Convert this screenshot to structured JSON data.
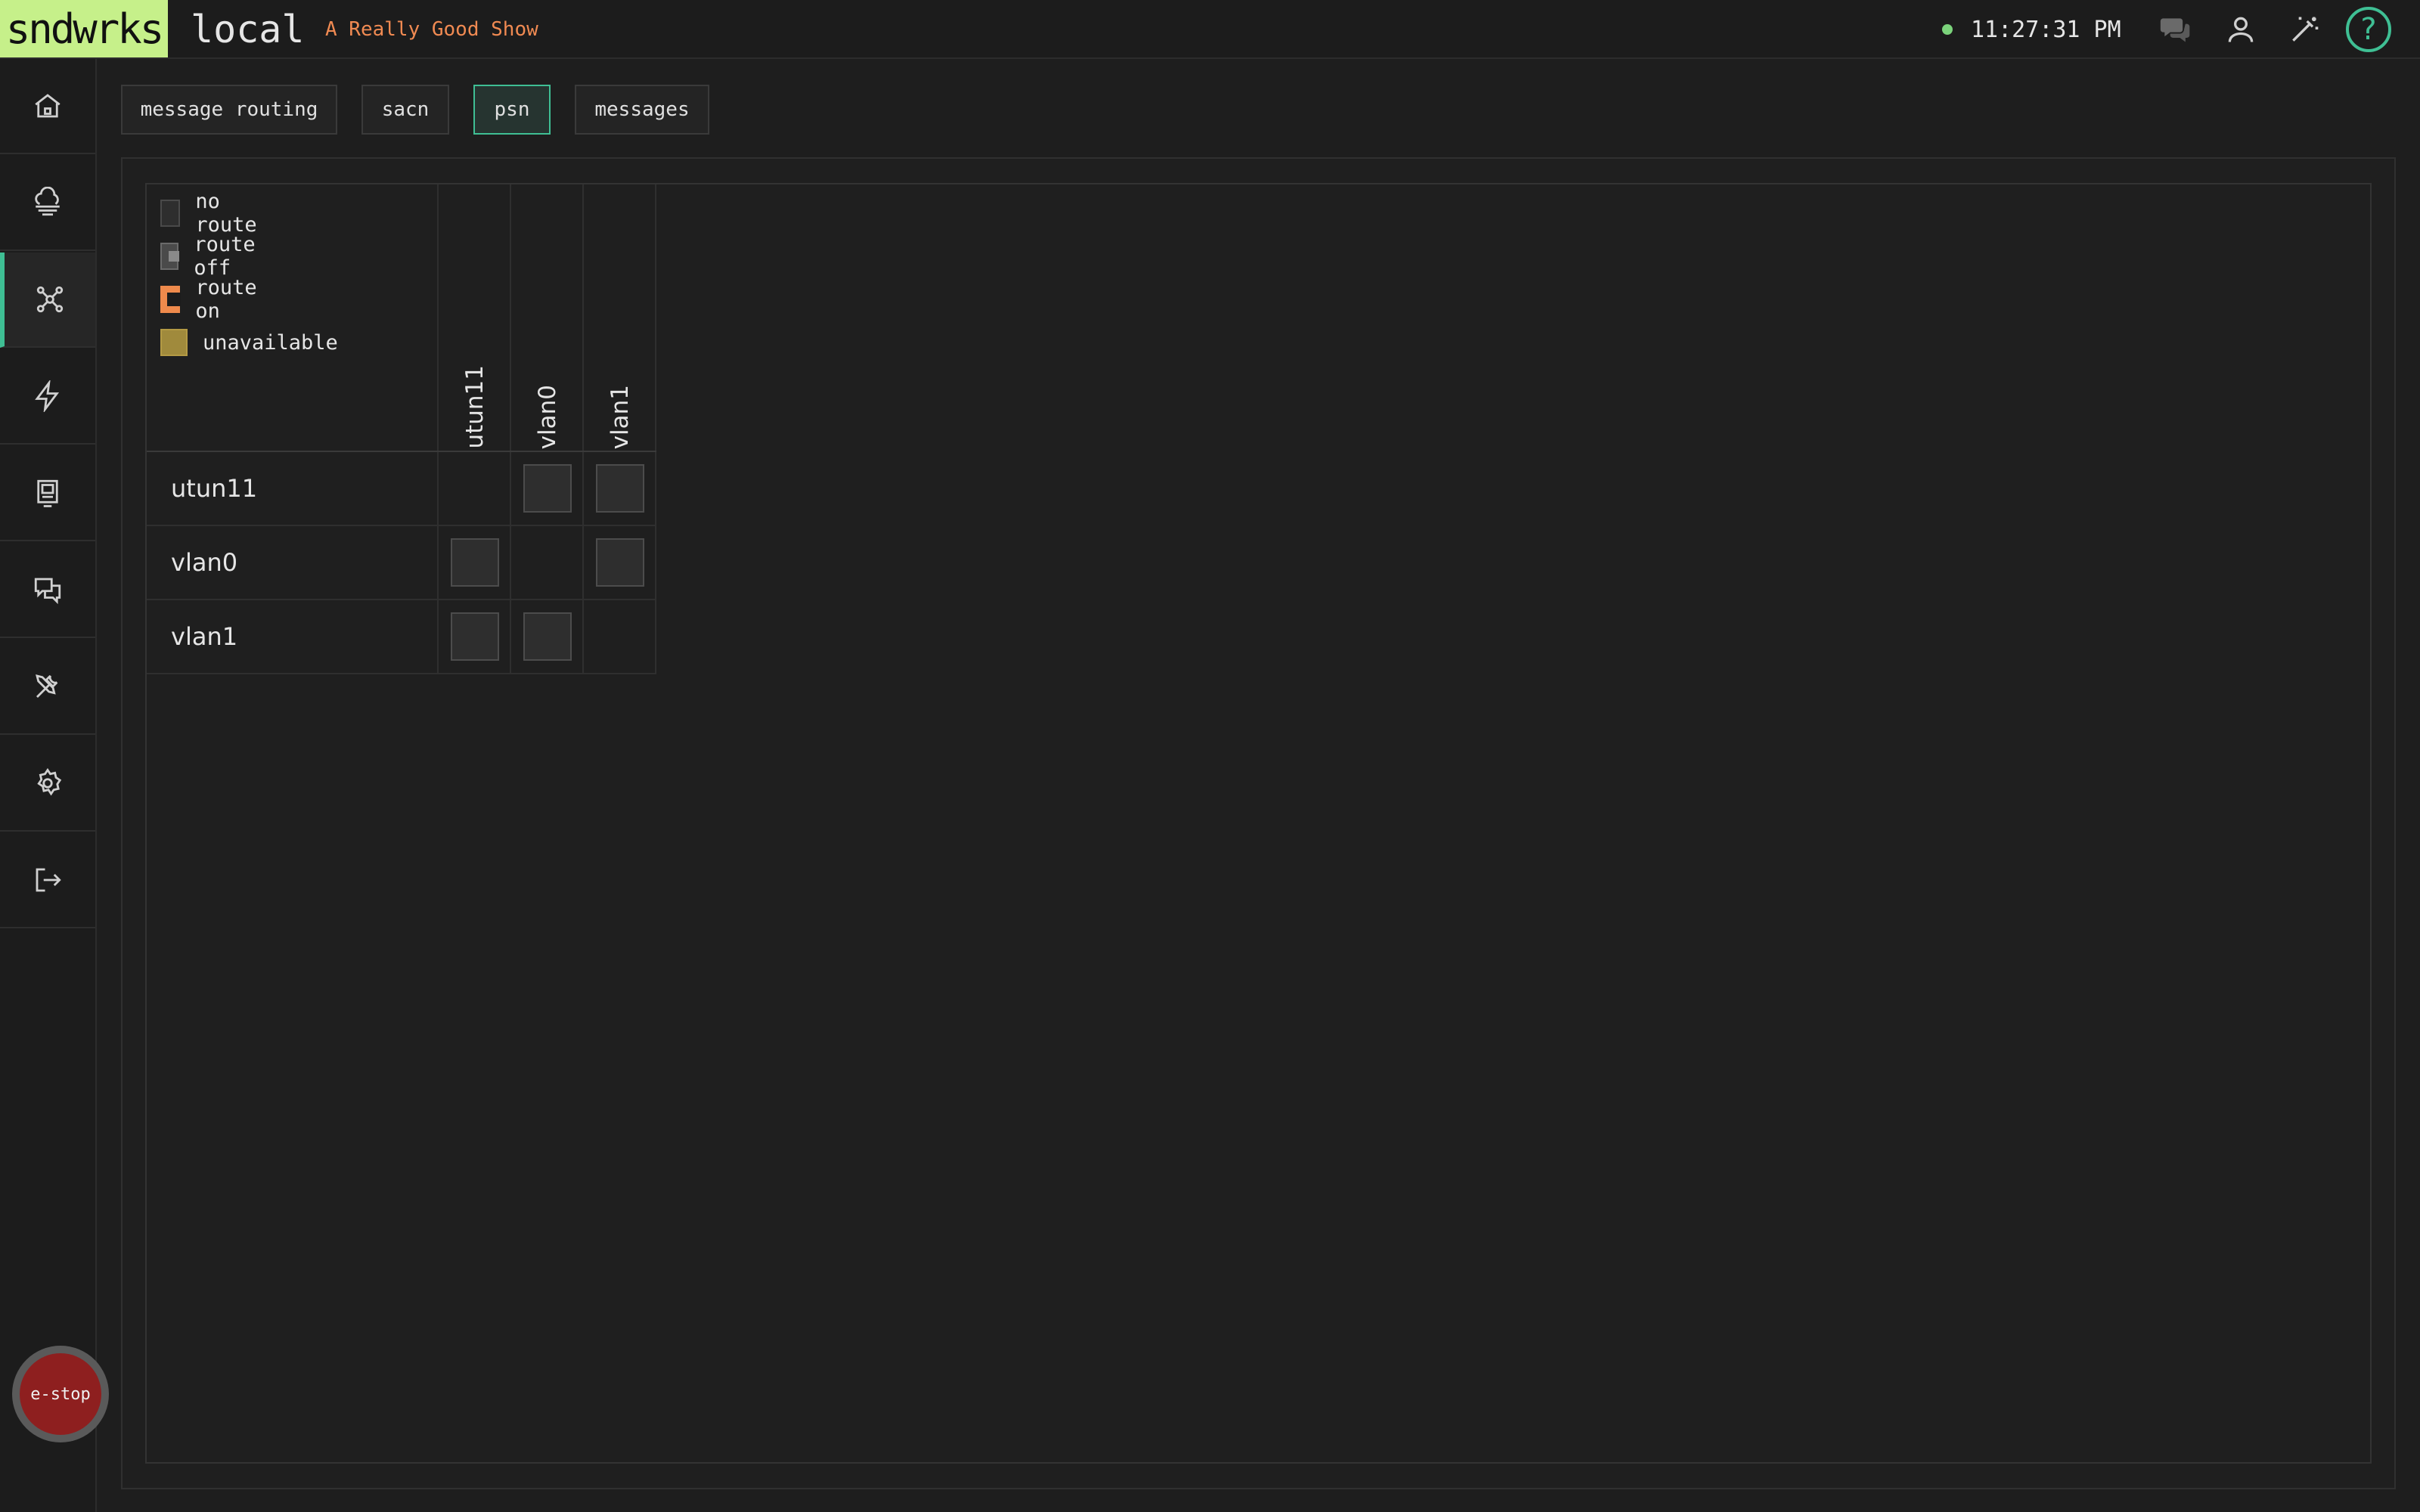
{
  "header": {
    "brand": "sndwrks",
    "instance": "local",
    "show_name": "A Really Good Show",
    "clock": "11:27:31 PM",
    "status_color": "#7bd37b",
    "help_label": "?",
    "icons": [
      "chat-icon",
      "user-icon",
      "magic-wand-icon",
      "help-icon"
    ]
  },
  "sidebar": {
    "items": [
      {
        "name": "home",
        "icon": "home-icon"
      },
      {
        "name": "cloud",
        "icon": "cloud-icon"
      },
      {
        "name": "network",
        "icon": "network-icon",
        "active": true
      },
      {
        "name": "triggers",
        "icon": "lightning-icon"
      },
      {
        "name": "display",
        "icon": "monitor-icon"
      },
      {
        "name": "messages",
        "icon": "chat-bubbles-icon"
      },
      {
        "name": "tools",
        "icon": "tools-icon"
      },
      {
        "name": "settings",
        "icon": "gear-icon"
      },
      {
        "name": "logout",
        "icon": "logout-icon"
      }
    ],
    "estop_label": "e-stop"
  },
  "tabs": [
    {
      "label": "message routing",
      "active": false
    },
    {
      "label": "sacn",
      "active": false
    },
    {
      "label": "psn",
      "active": true
    },
    {
      "label": "messages",
      "active": false
    }
  ],
  "legend": [
    {
      "label": "no route",
      "state": "none"
    },
    {
      "label": "route off",
      "state": "off"
    },
    {
      "label": "route on",
      "state": "on"
    },
    {
      "label": "unavailable",
      "state": "unavail"
    }
  ],
  "matrix": {
    "columns": [
      "utun11",
      "vlan0",
      "vlan1"
    ],
    "rows": [
      {
        "label": "utun11",
        "cells": [
          "self",
          "none",
          "none"
        ]
      },
      {
        "label": "vlan0",
        "cells": [
          "none",
          "self",
          "none"
        ]
      },
      {
        "label": "vlan1",
        "cells": [
          "none",
          "none",
          "self"
        ]
      }
    ]
  },
  "colors": {
    "brand_bg": "#c6f08a",
    "accent": "#3fbf94",
    "show_name": "#f08a52",
    "route_on": "#ef8a4c",
    "unavailable": "#a08a3c",
    "estop": "#8e1f1f"
  }
}
